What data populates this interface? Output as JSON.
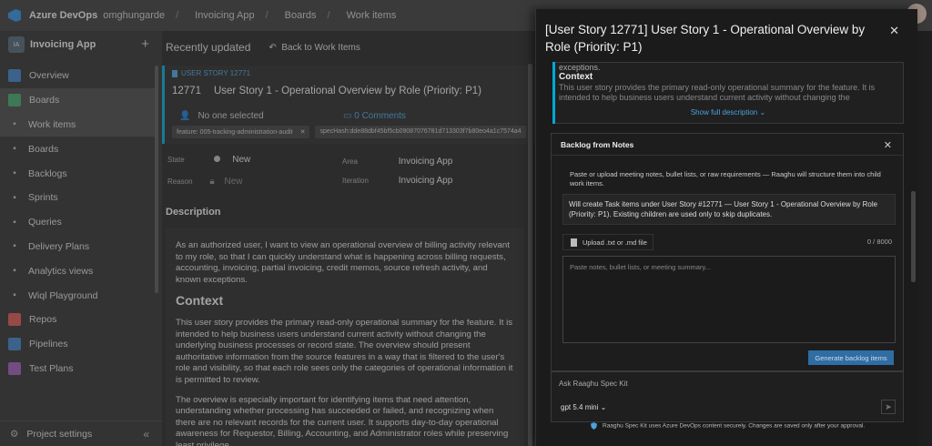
{
  "topbar": {
    "brand": "Azure DevOps",
    "crumbs": [
      "omghungarde",
      "Invoicing App",
      "Boards",
      "Work items"
    ]
  },
  "sidebar": {
    "project_initials": "IA",
    "project_name": "Invoicing App",
    "items": [
      {
        "label": "Overview",
        "icon": "overview-icon",
        "color": "#3b7fc4"
      },
      {
        "label": "Boards",
        "icon": "boards-icon",
        "color": "#3fa66a"
      },
      {
        "label": "Work items",
        "icon": "work-items-icon",
        "sub": true
      },
      {
        "label": "Boards",
        "icon": "board-icon",
        "sub": true
      },
      {
        "label": "Backlogs",
        "icon": "backlogs-icon",
        "sub": true
      },
      {
        "label": "Sprints",
        "icon": "sprints-icon",
        "sub": true
      },
      {
        "label": "Queries",
        "icon": "queries-icon",
        "sub": true
      },
      {
        "label": "Delivery Plans",
        "icon": "delivery-plans-icon",
        "sub": true
      },
      {
        "label": "Analytics views",
        "icon": "analytics-icon",
        "sub": true
      },
      {
        "label": "Wiql Playground",
        "icon": "wiql-icon",
        "sub": true
      },
      {
        "label": "Repos",
        "icon": "repos-icon",
        "color": "#d9534f"
      },
      {
        "label": "Pipelines",
        "icon": "pipelines-icon",
        "color": "#3b7fc4"
      },
      {
        "label": "Test Plans",
        "icon": "test-plans-icon",
        "color": "#9b59b6"
      }
    ],
    "settings_label": "Project settings"
  },
  "main": {
    "recent": "Recently updated",
    "back": "Back to Work Items",
    "work_item": {
      "type": "USER STORY 12771",
      "id": "12771",
      "title": "User Story 1 - Operational Overview by Role (Priority: P1)",
      "assigned": "No one selected",
      "comments": "0 Comments",
      "tag1": "feature: 005-tracking-administration-audit",
      "tag2": "specHash:dde88dbf45bf5cb09087076781d713303f7b80eo4a1c7574a4"
    },
    "fields": {
      "state_label": "State",
      "state_value": "New",
      "reason_label": "Reason",
      "reason_value": "New",
      "area_label": "Area",
      "area_value": "Invoicing App",
      "iteration_label": "Iteration",
      "iteration_value": "Invoicing App"
    },
    "description_heading": "Description",
    "description": {
      "p1": "As an authorized user, I want to view an operational overview of billing activity relevant to my role, so that I can quickly understand what is happening across billing requests, accounting, invoicing, partial invoicing, credit memos, source refresh activity, and known exceptions.",
      "context_heading": "Context",
      "p2": "This user story provides the primary read-only operational summary for the feature. It is intended to help business users understand current activity without changing the underlying business processes or record state. The overview should present authoritative information from the source features in a way that is filtered to the user's role and visibility, so that each role sees only the categories of operational information it is permitted to review.",
      "p3": "The overview is especially important for identifying items that need attention, understanding whether processing has succeeded or failed, and recognizing when there are no relevant records for the current user. It supports day-to-day operational awareness for Requestor, Billing, Accounting, and Administrator roles while preserving least privilege."
    }
  },
  "panel": {
    "title": "[User Story 12771] User Story 1 - Operational Overview by Role (Priority: P1)",
    "desc_preview": {
      "exceptions": "exceptions.",
      "context": "Context",
      "text": "This user story provides the primary read-only operational summary for the feature. It is intended to help business users understand current activity without changing the",
      "show_full": "Show full description"
    },
    "backlog": {
      "title": "Backlog from Notes",
      "intro": "Paste or upload meeting notes, bullet lists, or raw requirements — Raaghu will structure them into child work items.",
      "note": "Will create Task items under User Story #12771 — User Story 1 - Operational Overview by Role (Priority: P1). Existing children are used only to skip duplicates.",
      "upload": "Upload .txt or .md file",
      "count": "0 / 8000",
      "placeholder": "Paste notes, bullet lists, or meeting summary...",
      "generate": "Generate backlog items"
    },
    "ask": {
      "placeholder": "Ask Raaghu Spec Kit",
      "model": "gpt 5.4  mini"
    },
    "footer": "Raaghu Spec Kit uses Azure DevOps content securely. Changes are saved only after your approval."
  }
}
